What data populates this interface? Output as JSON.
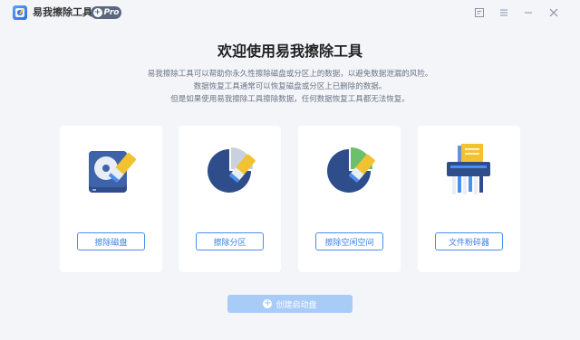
{
  "app": {
    "name": "易我擦除工具",
    "badge": "Pro",
    "badge_plus": "+"
  },
  "window_controls": {
    "feedback_icon": "feedback-icon",
    "menu_icon": "menu-icon",
    "minimize_icon": "minimize-icon",
    "close_icon": "close-icon"
  },
  "main": {
    "headline": "欢迎使用易我擦除工具",
    "description": [
      "易我擦除工具可以帮助你永久性擦除磁盘或分区上的数据，以避免数据泄漏的风险。",
      "数据恢复工具通常可以恢复磁盘或分区上已删除的数据。",
      "但是如果使用易我擦除工具擦除数据，任何数据恢复工具都无法恢复。"
    ]
  },
  "cards": [
    {
      "label": "擦除磁盘",
      "icon": "disk-eraser-icon"
    },
    {
      "label": "擦除分区",
      "icon": "partition-eraser-icon"
    },
    {
      "label": "擦除空闲空间",
      "icon": "free-space-eraser-icon"
    },
    {
      "label": "文件粉碎器",
      "icon": "file-shredder-icon"
    }
  ],
  "boot": {
    "label": "创建启动盘",
    "plus": "+"
  },
  "colors": {
    "accent": "#3b7fe6",
    "background": "#f3f5f9",
    "boot_button": "#a9cbf7",
    "pie_dark": "#2f4d8a",
    "pie_green": "#6cc06a",
    "eraser_yellow": "#f2c230"
  }
}
